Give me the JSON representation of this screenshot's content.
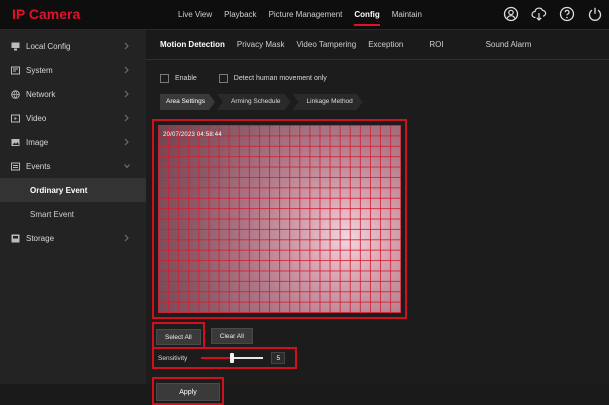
{
  "app": {
    "brand": "IP Camera",
    "accent": "#e0112b"
  },
  "nav": {
    "live_view": "Live View",
    "playback": "Playback",
    "picture_management": "Picture Management",
    "config": "Config",
    "maintain": "Maintain"
  },
  "top_icons": [
    "user-icon",
    "download-icon",
    "help-icon",
    "power-icon"
  ],
  "sidebar": {
    "local_config": "Local Config",
    "system": "System",
    "network": "Network",
    "video": "Video",
    "image": "Image",
    "events": "Events",
    "ordinary_event": "Ordinary Event",
    "smart_event": "Smart Event",
    "storage": "Storage"
  },
  "tabs": {
    "motion_detection": "Motion Detection",
    "privacy_mask": "Privacy Mask",
    "video_tampering": "Video Tampering",
    "exception": "Exception",
    "roi": "ROI",
    "sound_alarm": "Sound Alarm"
  },
  "options": {
    "enable": "Enable",
    "detect_human": "Detect human movement only"
  },
  "subtabs": {
    "area_settings": "Area Settings",
    "arming_schedule": "Arming Schedule",
    "linkage_method": "Linkage Method"
  },
  "video": {
    "timestamp": "20/07/2023 04:58:44"
  },
  "buttons": {
    "select_all": "Select All",
    "clear_all": "Clear All",
    "apply": "Apply"
  },
  "sensitivity": {
    "label": "Sensitivity",
    "value": "5",
    "level_fraction": 0.5
  }
}
